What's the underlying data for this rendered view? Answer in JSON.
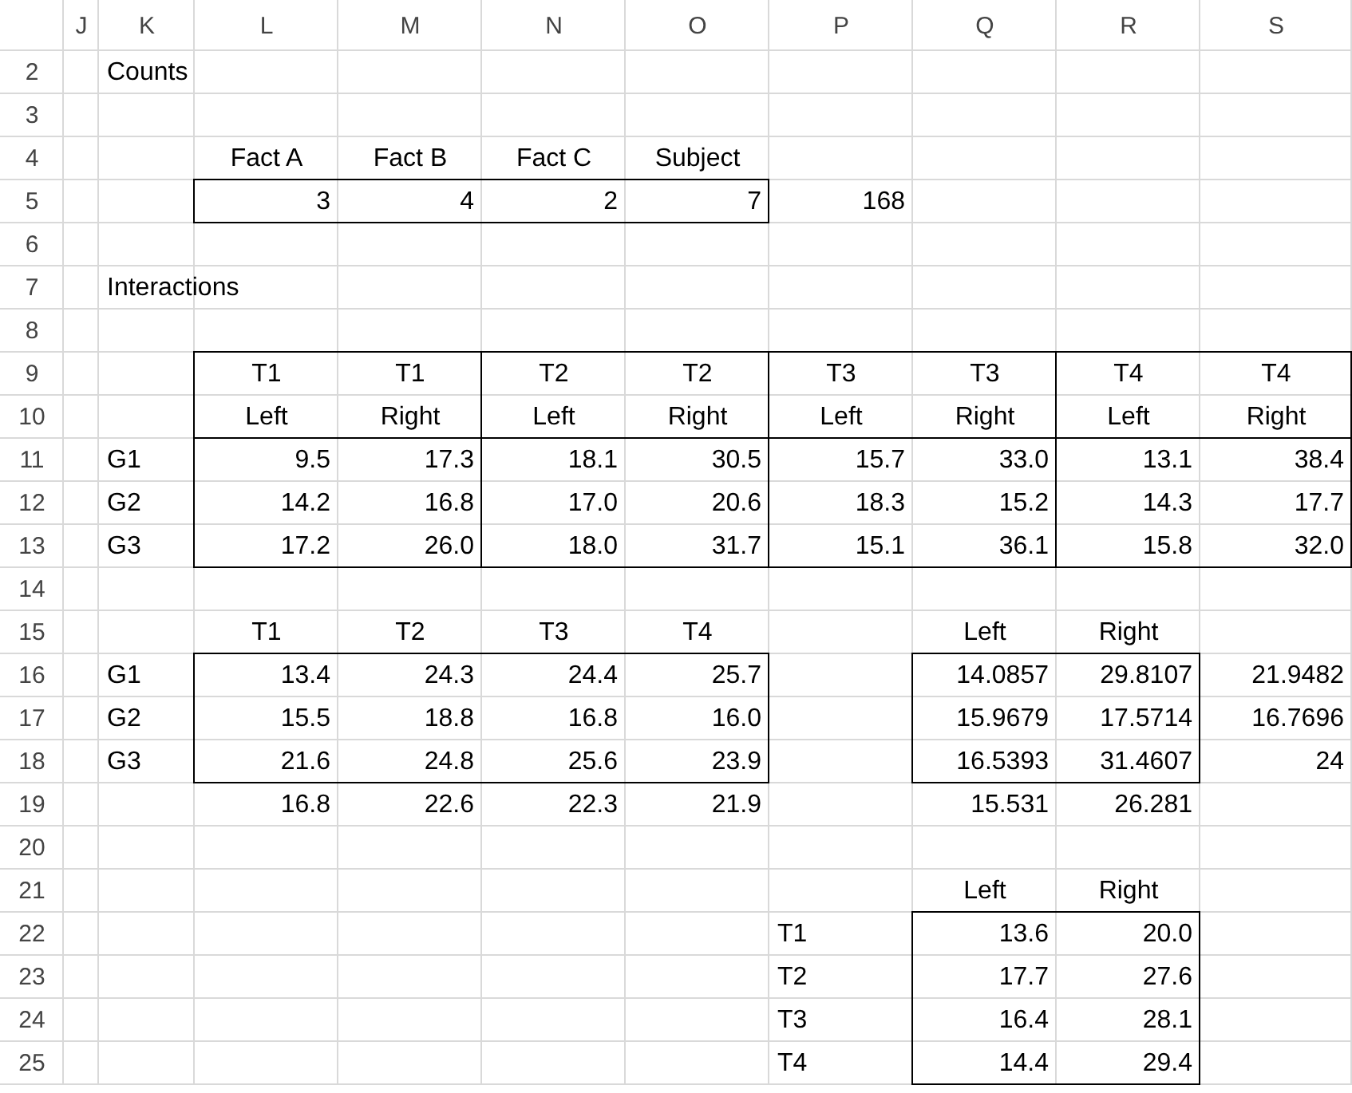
{
  "column_headers": [
    "J",
    "K",
    "L",
    "M",
    "N",
    "O",
    "P",
    "Q",
    "R",
    "S"
  ],
  "rows": [
    {
      "number": "2",
      "cells": {
        "K": {
          "kind": "label",
          "text": "Counts"
        }
      }
    },
    {
      "number": "3",
      "cells": {}
    },
    {
      "number": "4",
      "cells": {
        "L": {
          "kind": "header",
          "text": "Fact A"
        },
        "M": {
          "kind": "header",
          "text": "Fact B"
        },
        "N": {
          "kind": "header",
          "text": "Fact C"
        },
        "O": {
          "kind": "header",
          "text": "Subject"
        }
      }
    },
    {
      "number": "5",
      "cells": {
        "L": {
          "kind": "number",
          "text": "3"
        },
        "M": {
          "kind": "number",
          "text": "4"
        },
        "N": {
          "kind": "number",
          "text": "2"
        },
        "O": {
          "kind": "number",
          "text": "7"
        },
        "P": {
          "kind": "number",
          "text": "168"
        }
      }
    },
    {
      "number": "6",
      "cells": {}
    },
    {
      "number": "7",
      "cells": {
        "K": {
          "kind": "label",
          "text": "Interactions"
        }
      }
    },
    {
      "number": "8",
      "cells": {}
    },
    {
      "number": "9",
      "cells": {
        "L": {
          "kind": "header",
          "text": "T1"
        },
        "M": {
          "kind": "header",
          "text": "T1"
        },
        "N": {
          "kind": "header",
          "text": "T2"
        },
        "O": {
          "kind": "header",
          "text": "T2"
        },
        "P": {
          "kind": "header",
          "text": "T3"
        },
        "Q": {
          "kind": "header",
          "text": "T3"
        },
        "R": {
          "kind": "header",
          "text": "T4"
        },
        "S": {
          "kind": "header",
          "text": "T4"
        }
      }
    },
    {
      "number": "10",
      "cells": {
        "L": {
          "kind": "header",
          "text": "Left"
        },
        "M": {
          "kind": "header",
          "text": "Right"
        },
        "N": {
          "kind": "header",
          "text": "Left"
        },
        "O": {
          "kind": "header",
          "text": "Right"
        },
        "P": {
          "kind": "header",
          "text": "Left"
        },
        "Q": {
          "kind": "header",
          "text": "Right"
        },
        "R": {
          "kind": "header",
          "text": "Left"
        },
        "S": {
          "kind": "header",
          "text": "Right"
        }
      }
    },
    {
      "number": "11",
      "cells": {
        "K": {
          "kind": "label",
          "text": "G1"
        },
        "L": {
          "kind": "number",
          "text": "9.5"
        },
        "M": {
          "kind": "number",
          "text": "17.3"
        },
        "N": {
          "kind": "number",
          "text": "18.1"
        },
        "O": {
          "kind": "number",
          "text": "30.5"
        },
        "P": {
          "kind": "number",
          "text": "15.7"
        },
        "Q": {
          "kind": "number",
          "text": "33.0"
        },
        "R": {
          "kind": "number",
          "text": "13.1"
        },
        "S": {
          "kind": "number",
          "text": "38.4"
        }
      }
    },
    {
      "number": "12",
      "cells": {
        "K": {
          "kind": "label",
          "text": "G2"
        },
        "L": {
          "kind": "number",
          "text": "14.2"
        },
        "M": {
          "kind": "number",
          "text": "16.8"
        },
        "N": {
          "kind": "number",
          "text": "17.0"
        },
        "O": {
          "kind": "number",
          "text": "20.6"
        },
        "P": {
          "kind": "number",
          "text": "18.3"
        },
        "Q": {
          "kind": "number",
          "text": "15.2"
        },
        "R": {
          "kind": "number",
          "text": "14.3"
        },
        "S": {
          "kind": "number",
          "text": "17.7"
        }
      }
    },
    {
      "number": "13",
      "cells": {
        "K": {
          "kind": "label",
          "text": "G3"
        },
        "L": {
          "kind": "number",
          "text": "17.2"
        },
        "M": {
          "kind": "number",
          "text": "26.0"
        },
        "N": {
          "kind": "number",
          "text": "18.0"
        },
        "O": {
          "kind": "number",
          "text": "31.7"
        },
        "P": {
          "kind": "number",
          "text": "15.1"
        },
        "Q": {
          "kind": "number",
          "text": "36.1"
        },
        "R": {
          "kind": "number",
          "text": "15.8"
        },
        "S": {
          "kind": "number",
          "text": "32.0"
        }
      }
    },
    {
      "number": "14",
      "cells": {}
    },
    {
      "number": "15",
      "cells": {
        "L": {
          "kind": "header",
          "text": "T1"
        },
        "M": {
          "kind": "header",
          "text": "T2"
        },
        "N": {
          "kind": "header",
          "text": "T3"
        },
        "O": {
          "kind": "header",
          "text": "T4"
        },
        "Q": {
          "kind": "header",
          "text": "Left"
        },
        "R": {
          "kind": "header",
          "text": "Right"
        }
      }
    },
    {
      "number": "16",
      "cells": {
        "K": {
          "kind": "label",
          "text": "G1"
        },
        "L": {
          "kind": "number",
          "text": "13.4"
        },
        "M": {
          "kind": "number",
          "text": "24.3"
        },
        "N": {
          "kind": "number",
          "text": "24.4"
        },
        "O": {
          "kind": "number",
          "text": "25.7"
        },
        "Q": {
          "kind": "number",
          "text": "14.0857"
        },
        "R": {
          "kind": "number",
          "text": "29.8107"
        },
        "S": {
          "kind": "number",
          "text": "21.9482"
        }
      }
    },
    {
      "number": "17",
      "cells": {
        "K": {
          "kind": "label",
          "text": "G2"
        },
        "L": {
          "kind": "number",
          "text": "15.5"
        },
        "M": {
          "kind": "number",
          "text": "18.8"
        },
        "N": {
          "kind": "number",
          "text": "16.8"
        },
        "O": {
          "kind": "number",
          "text": "16.0"
        },
        "Q": {
          "kind": "number",
          "text": "15.9679"
        },
        "R": {
          "kind": "number",
          "text": "17.5714"
        },
        "S": {
          "kind": "number",
          "text": "16.7696"
        }
      }
    },
    {
      "number": "18",
      "cells": {
        "K": {
          "kind": "label",
          "text": "G3"
        },
        "L": {
          "kind": "number",
          "text": "21.6"
        },
        "M": {
          "kind": "number",
          "text": "24.8"
        },
        "N": {
          "kind": "number",
          "text": "25.6"
        },
        "O": {
          "kind": "number",
          "text": "23.9"
        },
        "Q": {
          "kind": "number",
          "text": "16.5393"
        },
        "R": {
          "kind": "number",
          "text": "31.4607"
        },
        "S": {
          "kind": "number",
          "text": "24"
        }
      }
    },
    {
      "number": "19",
      "cells": {
        "L": {
          "kind": "number",
          "text": "16.8"
        },
        "M": {
          "kind": "number",
          "text": "22.6"
        },
        "N": {
          "kind": "number",
          "text": "22.3"
        },
        "O": {
          "kind": "number",
          "text": "21.9"
        },
        "Q": {
          "kind": "number",
          "text": "15.531"
        },
        "R": {
          "kind": "number",
          "text": "26.281"
        }
      }
    },
    {
      "number": "20",
      "cells": {}
    },
    {
      "number": "21",
      "cells": {
        "Q": {
          "kind": "header",
          "text": "Left"
        },
        "R": {
          "kind": "header",
          "text": "Right"
        }
      }
    },
    {
      "number": "22",
      "cells": {
        "P": {
          "kind": "label",
          "text": "T1"
        },
        "Q": {
          "kind": "number",
          "text": "13.6"
        },
        "R": {
          "kind": "number",
          "text": "20.0"
        }
      }
    },
    {
      "number": "23",
      "cells": {
        "P": {
          "kind": "label",
          "text": "T2"
        },
        "Q": {
          "kind": "number",
          "text": "17.7"
        },
        "R": {
          "kind": "number",
          "text": "27.6"
        }
      }
    },
    {
      "number": "24",
      "cells": {
        "P": {
          "kind": "label",
          "text": "T3"
        },
        "Q": {
          "kind": "number",
          "text": "16.4"
        },
        "R": {
          "kind": "number",
          "text": "28.1"
        }
      }
    },
    {
      "number": "25",
      "cells": {
        "P": {
          "kind": "label",
          "text": "T4"
        },
        "Q": {
          "kind": "number",
          "text": "14.4"
        },
        "R": {
          "kind": "number",
          "text": "29.4"
        }
      }
    }
  ]
}
